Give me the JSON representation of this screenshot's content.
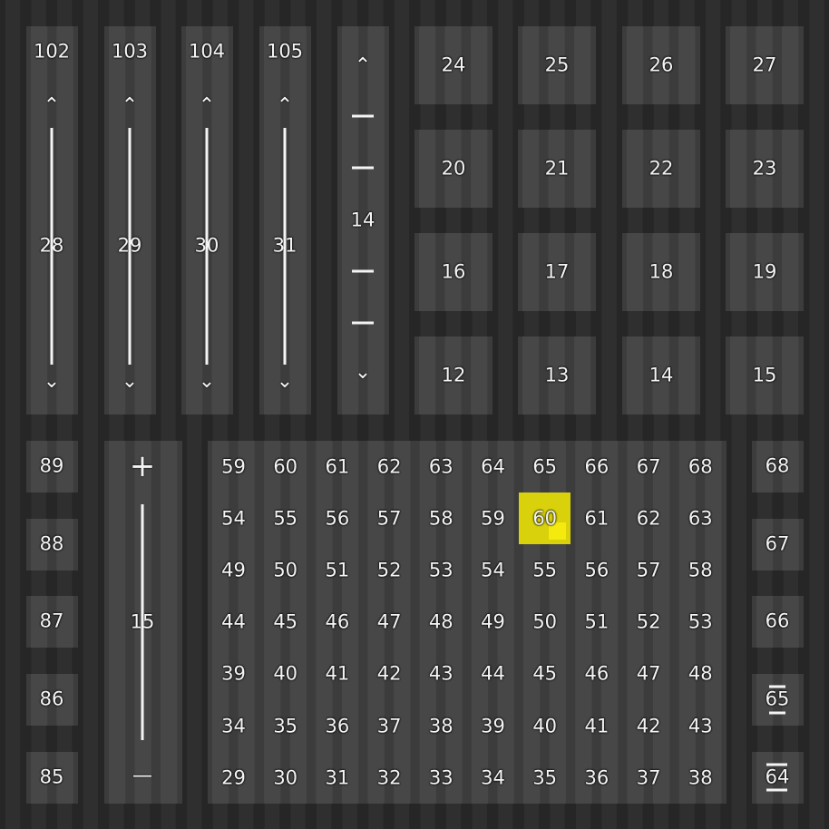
{
  "level_columns": [
    {
      "top": "102",
      "mid": "28"
    },
    {
      "top": "103",
      "mid": "29"
    },
    {
      "top": "104",
      "mid": "30"
    },
    {
      "top": "105",
      "mid": "31"
    }
  ],
  "zoom_column": {
    "mid": "14"
  },
  "top_grid": [
    "24",
    "25",
    "26",
    "27",
    "20",
    "21",
    "22",
    "23",
    "16",
    "17",
    "18",
    "19",
    "12",
    "13",
    "14",
    "15"
  ],
  "left_buttons": [
    "89",
    "88",
    "87",
    "86",
    "85"
  ],
  "vertical_slider": {
    "mid": "15"
  },
  "right_buttons": [
    "68",
    "67",
    "66",
    "65",
    "64"
  ],
  "main_grid": [
    [
      "59",
      "60",
      "61",
      "62",
      "63",
      "64",
      "65",
      "66",
      "67",
      "68"
    ],
    [
      "54",
      "55",
      "56",
      "57",
      "58",
      "59",
      "60",
      "61",
      "62",
      "63"
    ],
    [
      "49",
      "50",
      "51",
      "52",
      "53",
      "54",
      "55",
      "56",
      "57",
      "58"
    ],
    [
      "44",
      "45",
      "46",
      "47",
      "48",
      "49",
      "50",
      "51",
      "52",
      "53"
    ],
    [
      "39",
      "40",
      "41",
      "42",
      "43",
      "44",
      "45",
      "46",
      "47",
      "48"
    ],
    [
      "34",
      "35",
      "36",
      "37",
      "38",
      "39",
      "40",
      "41",
      "42",
      "43"
    ],
    [
      "29",
      "30",
      "31",
      "32",
      "33",
      "34",
      "35",
      "36",
      "37",
      "38"
    ]
  ],
  "selected_cell": {
    "row": 1,
    "col": 6,
    "color": "#d8d10b"
  },
  "glyphs": {
    "up": "⌃",
    "down": "⌄",
    "plus": "+",
    "minus": "—"
  }
}
